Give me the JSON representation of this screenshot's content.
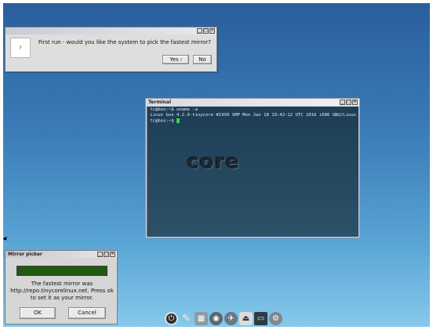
{
  "first_run": {
    "icon": "?",
    "message": "First run - would you like the system to pick the fastest mirror?",
    "yes_label": "Yes",
    "no_label": "No"
  },
  "terminal": {
    "title": "Terminal",
    "lines": [
      "tc@box:~$ uname -a",
      "Linux box 4.2.9-tinycore #1999 SMP Mon Jan 18 19:42:12 UTC 2016 i686 GNU/Linux",
      "tc@box:~$ "
    ],
    "logo": "core"
  },
  "mirror_picker": {
    "title": "Mirror picker",
    "progress": 1.0,
    "message": "The fastest mirror was http://repo.tinycorelinux.net. Press ok to set it as your mirror.",
    "ok_label": "OK",
    "cancel_label": "Cancel"
  },
  "dock": {
    "icons": [
      "power-icon",
      "editor-icon",
      "control-panel-icon",
      "apps-icon",
      "network-icon",
      "mount-icon",
      "terminal-icon",
      "settings-icon"
    ]
  }
}
